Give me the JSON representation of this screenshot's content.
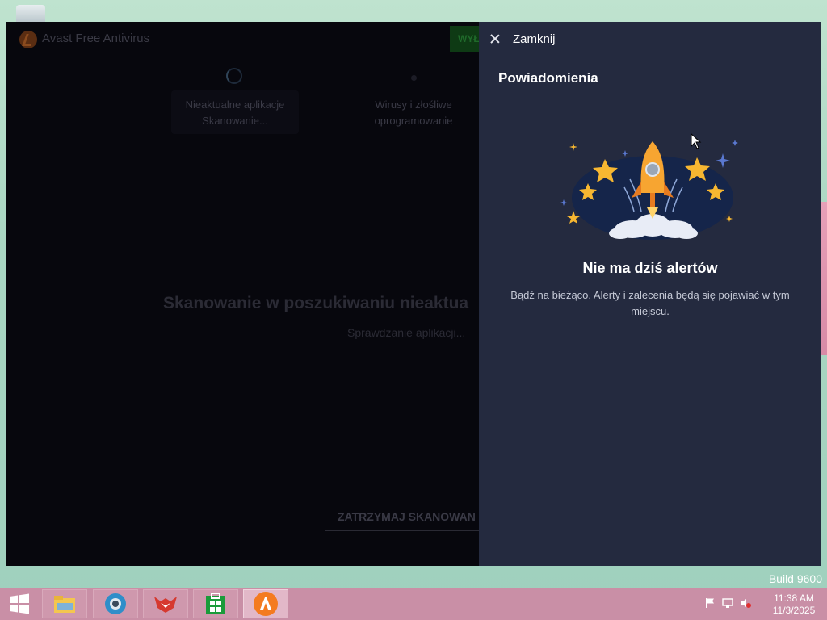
{
  "desktop": {
    "build_text": "Build 9600"
  },
  "app": {
    "title": "Avast Free Antivirus",
    "top_button_label": "WYŁ",
    "steps": [
      {
        "line1": "Nieaktualne aplikacje",
        "line2": "Skanowanie..."
      },
      {
        "line1": "Wirusy i złośliwe",
        "line2": "oprogramowanie"
      }
    ],
    "scan_heading": "Skanowanie w poszukiwaniu nieaktua",
    "scan_status": "Sprawdzanie aplikacji...",
    "stop_button": "ZATRZYMAJ SKANOWAN"
  },
  "panel": {
    "close_label": "Zamknij",
    "title": "Powiadomienia",
    "illustration_icon": "rocket-stars-illustration",
    "empty_title": "Nie ma dziś alertów",
    "empty_description": "Bądź na bieżąco. Alerty i zalecenia będą się pojawiać w tym miejscu."
  },
  "taskbar": {
    "apps": [
      {
        "name": "file-explorer-icon",
        "color": "#f4c64f"
      },
      {
        "name": "browser-globe-icon",
        "color": "#2f8ec9"
      },
      {
        "name": "fox-app-icon",
        "color": "#d6392f"
      },
      {
        "name": "store-icon",
        "color": "#1a9b3a"
      },
      {
        "name": "avast-icon",
        "color": "#f47b20"
      }
    ],
    "clock_time": "11:38 AM",
    "clock_date": "11/3/2025"
  }
}
